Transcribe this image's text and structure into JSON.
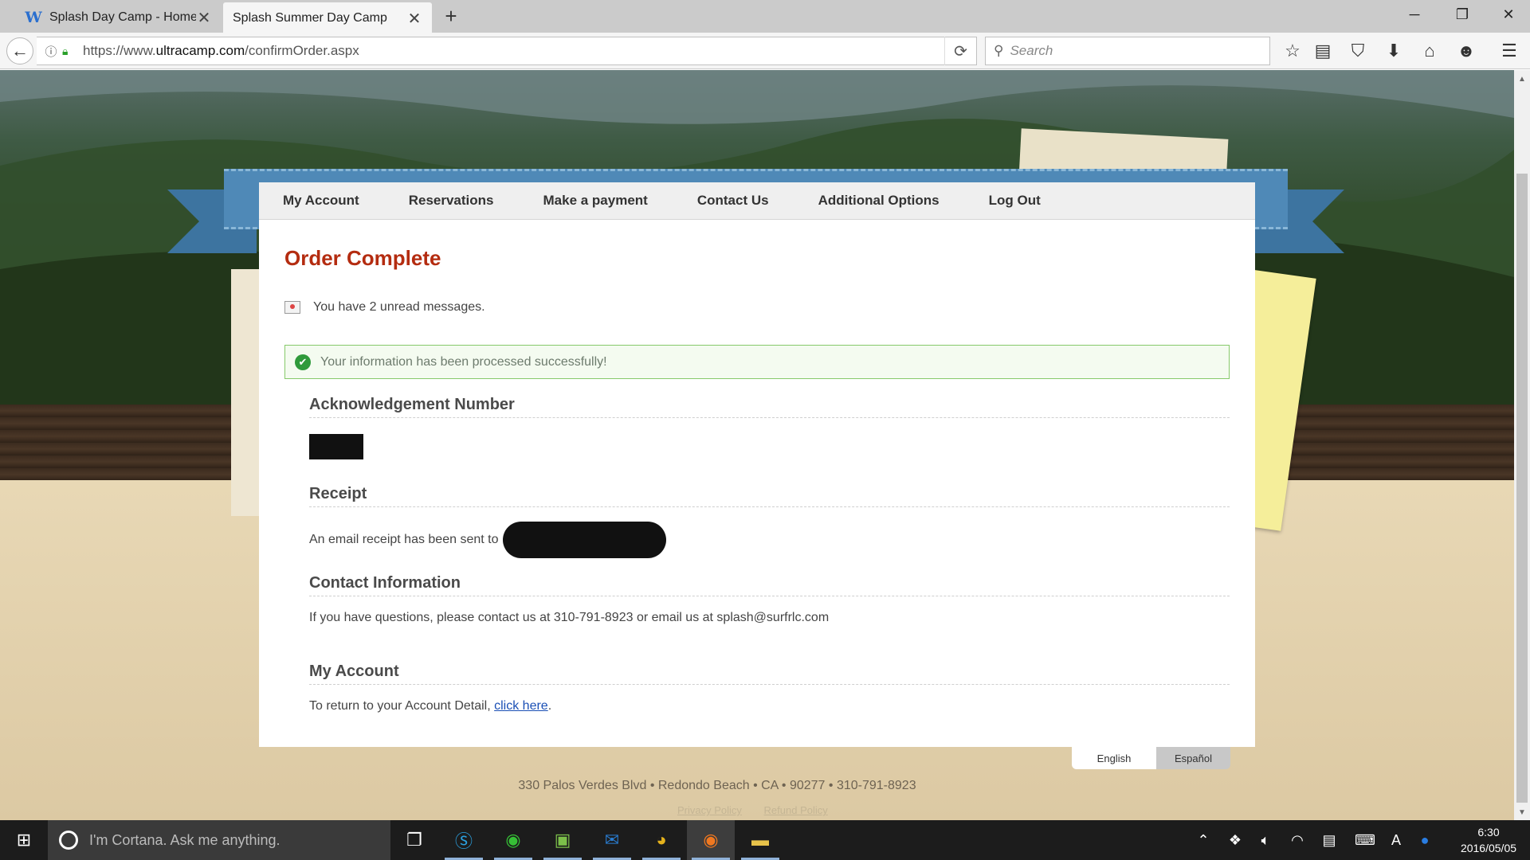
{
  "browser": {
    "tabs": [
      {
        "title": "Splash Day Camp - Home",
        "favicon": "W",
        "active": false
      },
      {
        "title": "Splash Summer Day Camp",
        "favicon": "",
        "active": true
      }
    ],
    "url_scheme": "https://www.",
    "url_host": "ultracamp.com",
    "url_path": "/confirmOrder.aspx",
    "search_placeholder": "Search"
  },
  "nav_menu": {
    "items": [
      "My Account",
      "Reservations",
      "Make a payment",
      "Contact Us",
      "Additional Options",
      "Log Out"
    ]
  },
  "page": {
    "title": "Order Complete",
    "messages_text": "You have 2 unread messages.",
    "success_text": "Your information has been processed successfully!",
    "sections": {
      "acknowledgement": {
        "heading": "Acknowledgement Number"
      },
      "receipt": {
        "heading": "Receipt",
        "text": "An email receipt has been sent to"
      },
      "contact": {
        "heading": "Contact Information",
        "text": "If you have questions, please contact us at 310-791-8923 or email us at splash@surfrlc.com"
      },
      "account": {
        "heading": "My Account",
        "text": "To return to your Account Detail,",
        "link": "click here",
        "suffix": "."
      }
    }
  },
  "language": {
    "english": "English",
    "espanol": "Español",
    "selected": "English"
  },
  "footer": {
    "address": "330 Palos Verdes Blvd • Redondo Beach • CA • 90277 • 310-791-8923",
    "privacy": "Privacy Policy",
    "refund": "Refund Policy"
  },
  "taskbar": {
    "cortana_placeholder": "I'm Cortana. Ask me anything.",
    "time": "6:30",
    "date": "2016/05/05",
    "ime": "A"
  },
  "colors": {
    "title_red": "#b42c10",
    "ribbon_blue": "#4f89b7",
    "success_green": "#2f9a3b",
    "link_blue": "#1a4fb5"
  }
}
